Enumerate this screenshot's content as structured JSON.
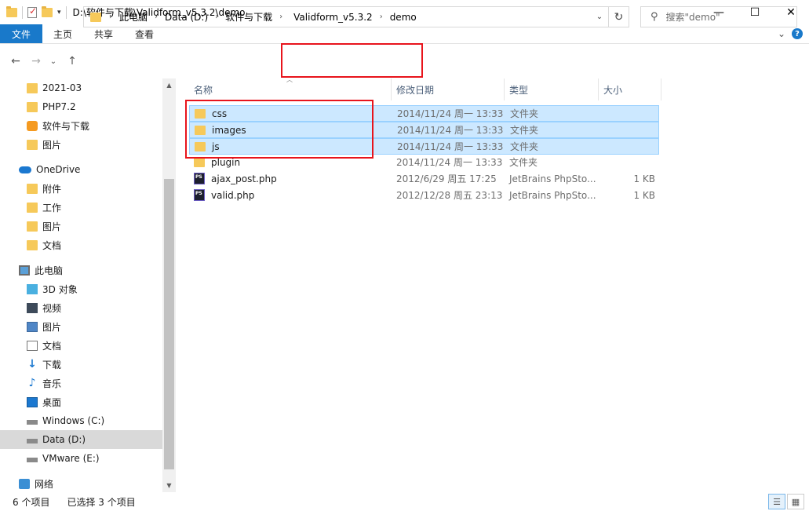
{
  "window": {
    "title": "D:\\软件与下载\\Validform_v5.3.2\\demo",
    "controls": {
      "minimize": "—",
      "maximize": "☐",
      "close": "✕"
    }
  },
  "ribbon": {
    "tabs": [
      "文件",
      "主页",
      "共享",
      "查看"
    ],
    "expand": "⌄",
    "help": "?"
  },
  "address": {
    "back": "←",
    "forward": "→",
    "recent": "⌄",
    "up": "↑",
    "crumbs": [
      "此电脑",
      "Data (D:)",
      "软件与下载",
      "Validform_v5.3.2",
      "demo"
    ],
    "separator": "›",
    "dropdown": "⌄",
    "refresh": "↻",
    "search_placeholder": "搜索\"demo\""
  },
  "nav": {
    "items": [
      {
        "label": "2021-03",
        "icon": "folder-icon",
        "indent": 1
      },
      {
        "label": "PHP7.2",
        "icon": "folder-icon",
        "indent": 1
      },
      {
        "label": "软件与下载",
        "icon": "software-icon",
        "indent": 1
      },
      {
        "label": "图片",
        "icon": "folder-icon",
        "indent": 1
      },
      {
        "label": "OneDrive",
        "icon": "onedrive-icon",
        "indent": 0
      },
      {
        "label": "附件",
        "icon": "folder-icon",
        "indent": 1
      },
      {
        "label": "工作",
        "icon": "folder-icon",
        "indent": 1
      },
      {
        "label": "图片",
        "icon": "folder-icon",
        "indent": 1
      },
      {
        "label": "文档",
        "icon": "folder-icon",
        "indent": 1
      },
      {
        "label": "此电脑",
        "icon": "this-pc-icon",
        "indent": 0
      },
      {
        "label": "3D 对象",
        "icon": "3d-objects-icon",
        "indent": 1
      },
      {
        "label": "视频",
        "icon": "video-icon",
        "indent": 1
      },
      {
        "label": "图片",
        "icon": "pictures-icon",
        "indent": 1
      },
      {
        "label": "文档",
        "icon": "documents-icon",
        "indent": 1
      },
      {
        "label": "下载",
        "icon": "download-icon",
        "indent": 1
      },
      {
        "label": "音乐",
        "icon": "music-icon",
        "indent": 1
      },
      {
        "label": "桌面",
        "icon": "desktop-icon",
        "indent": 1
      },
      {
        "label": "Windows (C:)",
        "icon": "drive-icon",
        "indent": 1
      },
      {
        "label": "Data (D:)",
        "icon": "drive-icon",
        "indent": 1,
        "selected": true
      },
      {
        "label": "VMware (E:)",
        "icon": "drive-icon",
        "indent": 1
      },
      {
        "label": "网络",
        "icon": "network-icon",
        "indent": 0
      }
    ]
  },
  "columns": {
    "name": "名称",
    "date": "修改日期",
    "type": "类型",
    "size": "大小"
  },
  "files": [
    {
      "name": "css",
      "date": "2014/11/24 周一 13:33",
      "type": "文件夹",
      "size": "",
      "kind": "folder",
      "selected": true
    },
    {
      "name": "images",
      "date": "2014/11/24 周一 13:33",
      "type": "文件夹",
      "size": "",
      "kind": "folder",
      "selected": true
    },
    {
      "name": "js",
      "date": "2014/11/24 周一 13:33",
      "type": "文件夹",
      "size": "",
      "kind": "folder",
      "selected": true
    },
    {
      "name": "plugin",
      "date": "2014/11/24 周一 13:33",
      "type": "文件夹",
      "size": "",
      "kind": "folder",
      "selected": false
    },
    {
      "name": "ajax_post.php",
      "date": "2012/6/29 周五 17:25",
      "type": "JetBrains PhpSto...",
      "size": "1 KB",
      "kind": "php",
      "selected": false
    },
    {
      "name": "valid.php",
      "date": "2012/12/28 周五 23:13",
      "type": "JetBrains PhpSto...",
      "size": "1 KB",
      "kind": "php",
      "selected": false
    }
  ],
  "status": {
    "count": "6 个项目",
    "selected": "已选择 3 个项目"
  },
  "colors": {
    "accent": "#1979ca",
    "selection": "#cce8ff",
    "highlight_box": "#e8141c"
  }
}
